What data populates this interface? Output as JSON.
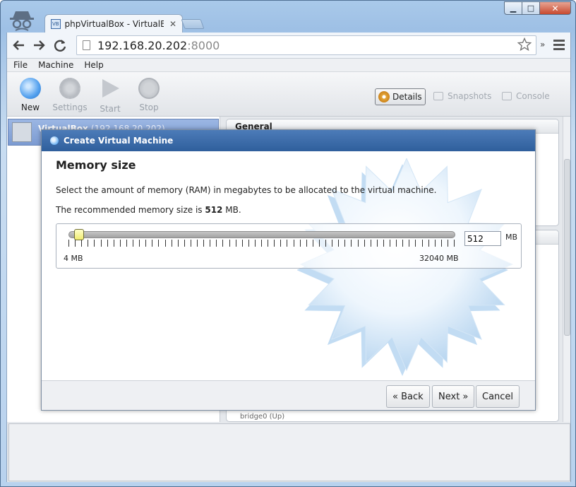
{
  "browser": {
    "tab_title": "phpVirtualBox - VirtualBox",
    "tab_close": "✕",
    "tab_favicon": "VB",
    "url_host": "192.168.20.202",
    "url_port": ":8000",
    "ext_more": "»",
    "icons": [
      "incognito-icon",
      "back-arrow-icon",
      "forward-arrow-icon",
      "reload-icon",
      "page-icon",
      "star-icon",
      "menu-icon"
    ],
    "window_controls": {
      "min": "▁",
      "max": "□",
      "close": "✕"
    }
  },
  "menubar": {
    "items": [
      "File",
      "Machine",
      "Help"
    ]
  },
  "toolbar": {
    "new": "New",
    "settings": "Settings",
    "start": "Start",
    "stop": "Stop"
  },
  "view_tabs": {
    "details": "Details",
    "snapshots": "Snapshots",
    "console": "Console"
  },
  "vm_list": {
    "name": "VirtualBox",
    "ip": "(192.168.20.202)"
  },
  "details": {
    "general_heading": "General",
    "network_peek": "bridge0 (Up)"
  },
  "dialog": {
    "title": "Create Virtual Machine",
    "heading": "Memory size",
    "description": "Select the amount of memory (RAM) in megabytes to be allocated to the virtual machine.",
    "recommended_prefix": "The recommended memory size is ",
    "recommended_value": "512",
    "recommended_suffix": " MB.",
    "slider": {
      "min_label": "4 MB",
      "max_label": "32040 MB",
      "min": 4,
      "max": 32040,
      "value": 512
    },
    "memory_value": "512",
    "unit": "MB",
    "buttons": {
      "back": "« Back",
      "next": "Next »",
      "cancel": "Cancel"
    }
  },
  "colors": {
    "dialog_title_bg": "#3a6aa8",
    "selected_row": "#8aa8da",
    "slider_handle": "#f5f28a"
  }
}
